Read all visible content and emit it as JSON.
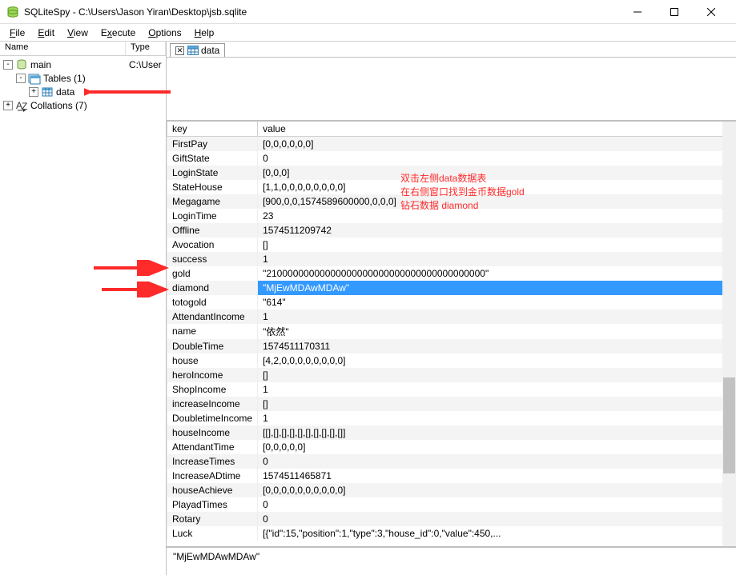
{
  "window": {
    "title": "SQLiteSpy - C:\\Users\\Jason Yiran\\Desktop\\jsb.sqlite"
  },
  "menu": {
    "file": "File",
    "edit": "Edit",
    "view": "View",
    "execute": "Execute",
    "options": "Options",
    "help": "Help"
  },
  "tree": {
    "header_name": "Name",
    "header_type": "Type",
    "items": [
      {
        "label": "main",
        "type": "C:\\User",
        "depth": 0,
        "expander": "-",
        "icon": "db"
      },
      {
        "label": "Tables (1)",
        "type": "",
        "depth": 1,
        "expander": "-",
        "icon": "tables"
      },
      {
        "label": "data",
        "type": "",
        "depth": 2,
        "expander": "+",
        "icon": "table"
      },
      {
        "label": "Collations (7)",
        "type": "",
        "depth": 0,
        "expander": "+",
        "icon": "coll"
      }
    ]
  },
  "tab": {
    "label": "data"
  },
  "grid": {
    "col_key": "key",
    "col_value": "value",
    "rows": [
      {
        "key": "FirstPay",
        "value": "[0,0,0,0,0,0]"
      },
      {
        "key": "GiftState",
        "value": "0"
      },
      {
        "key": "LoginState",
        "value": "[0,0,0]"
      },
      {
        "key": "StateHouse",
        "value": "[1,1,0,0,0,0,0,0,0,0]"
      },
      {
        "key": "Megagame",
        "value": "[900,0,0,1574589600000,0,0,0]"
      },
      {
        "key": "LoginTime",
        "value": "23"
      },
      {
        "key": "Offline",
        "value": "1574511209742"
      },
      {
        "key": "Avocation",
        "value": "[]"
      },
      {
        "key": "success",
        "value": "1"
      },
      {
        "key": "gold",
        "value": "\"21000000000000000000000000000000000000000\""
      },
      {
        "key": "diamond",
        "value": "\"MjEwMDAwMDAw\"",
        "selected": true
      },
      {
        "key": "totogold",
        "value": "\"614\""
      },
      {
        "key": "AttendantIncome",
        "value": "1"
      },
      {
        "key": "name",
        "value": "\"依然\""
      },
      {
        "key": "DoubleTime",
        "value": "1574511170311"
      },
      {
        "key": "house",
        "value": "[4,2,0,0,0,0,0,0,0,0]"
      },
      {
        "key": "heroIncome",
        "value": "[]"
      },
      {
        "key": "ShopIncome",
        "value": "1"
      },
      {
        "key": "increaseIncome",
        "value": "[]"
      },
      {
        "key": "DoubletimeIncome",
        "value": "1"
      },
      {
        "key": "houseIncome",
        "value": "[[],[],[],[],[],[],[],[],[],[]]"
      },
      {
        "key": "AttendantTime",
        "value": "[0,0,0,0,0]"
      },
      {
        "key": "IncreaseTimes",
        "value": "0"
      },
      {
        "key": "IncreaseADtime",
        "value": "1574511465871"
      },
      {
        "key": "houseAchieve",
        "value": "[0,0,0,0,0,0,0,0,0,0]"
      },
      {
        "key": "PlayadTimes",
        "value": "0"
      },
      {
        "key": "Rotary",
        "value": "0"
      },
      {
        "key": "Luck",
        "value": "[{\"id\":15,\"position\":1,\"type\":3,\"house_id\":0,\"value\":450,..."
      }
    ]
  },
  "bottom": {
    "value": "\"MjEwMDAwMDAw\""
  },
  "annotations": {
    "line1": "双击左侧data数据表",
    "line2": "在右侧窗口找到金币数据gold",
    "line3": "钻石数据 diamond"
  }
}
